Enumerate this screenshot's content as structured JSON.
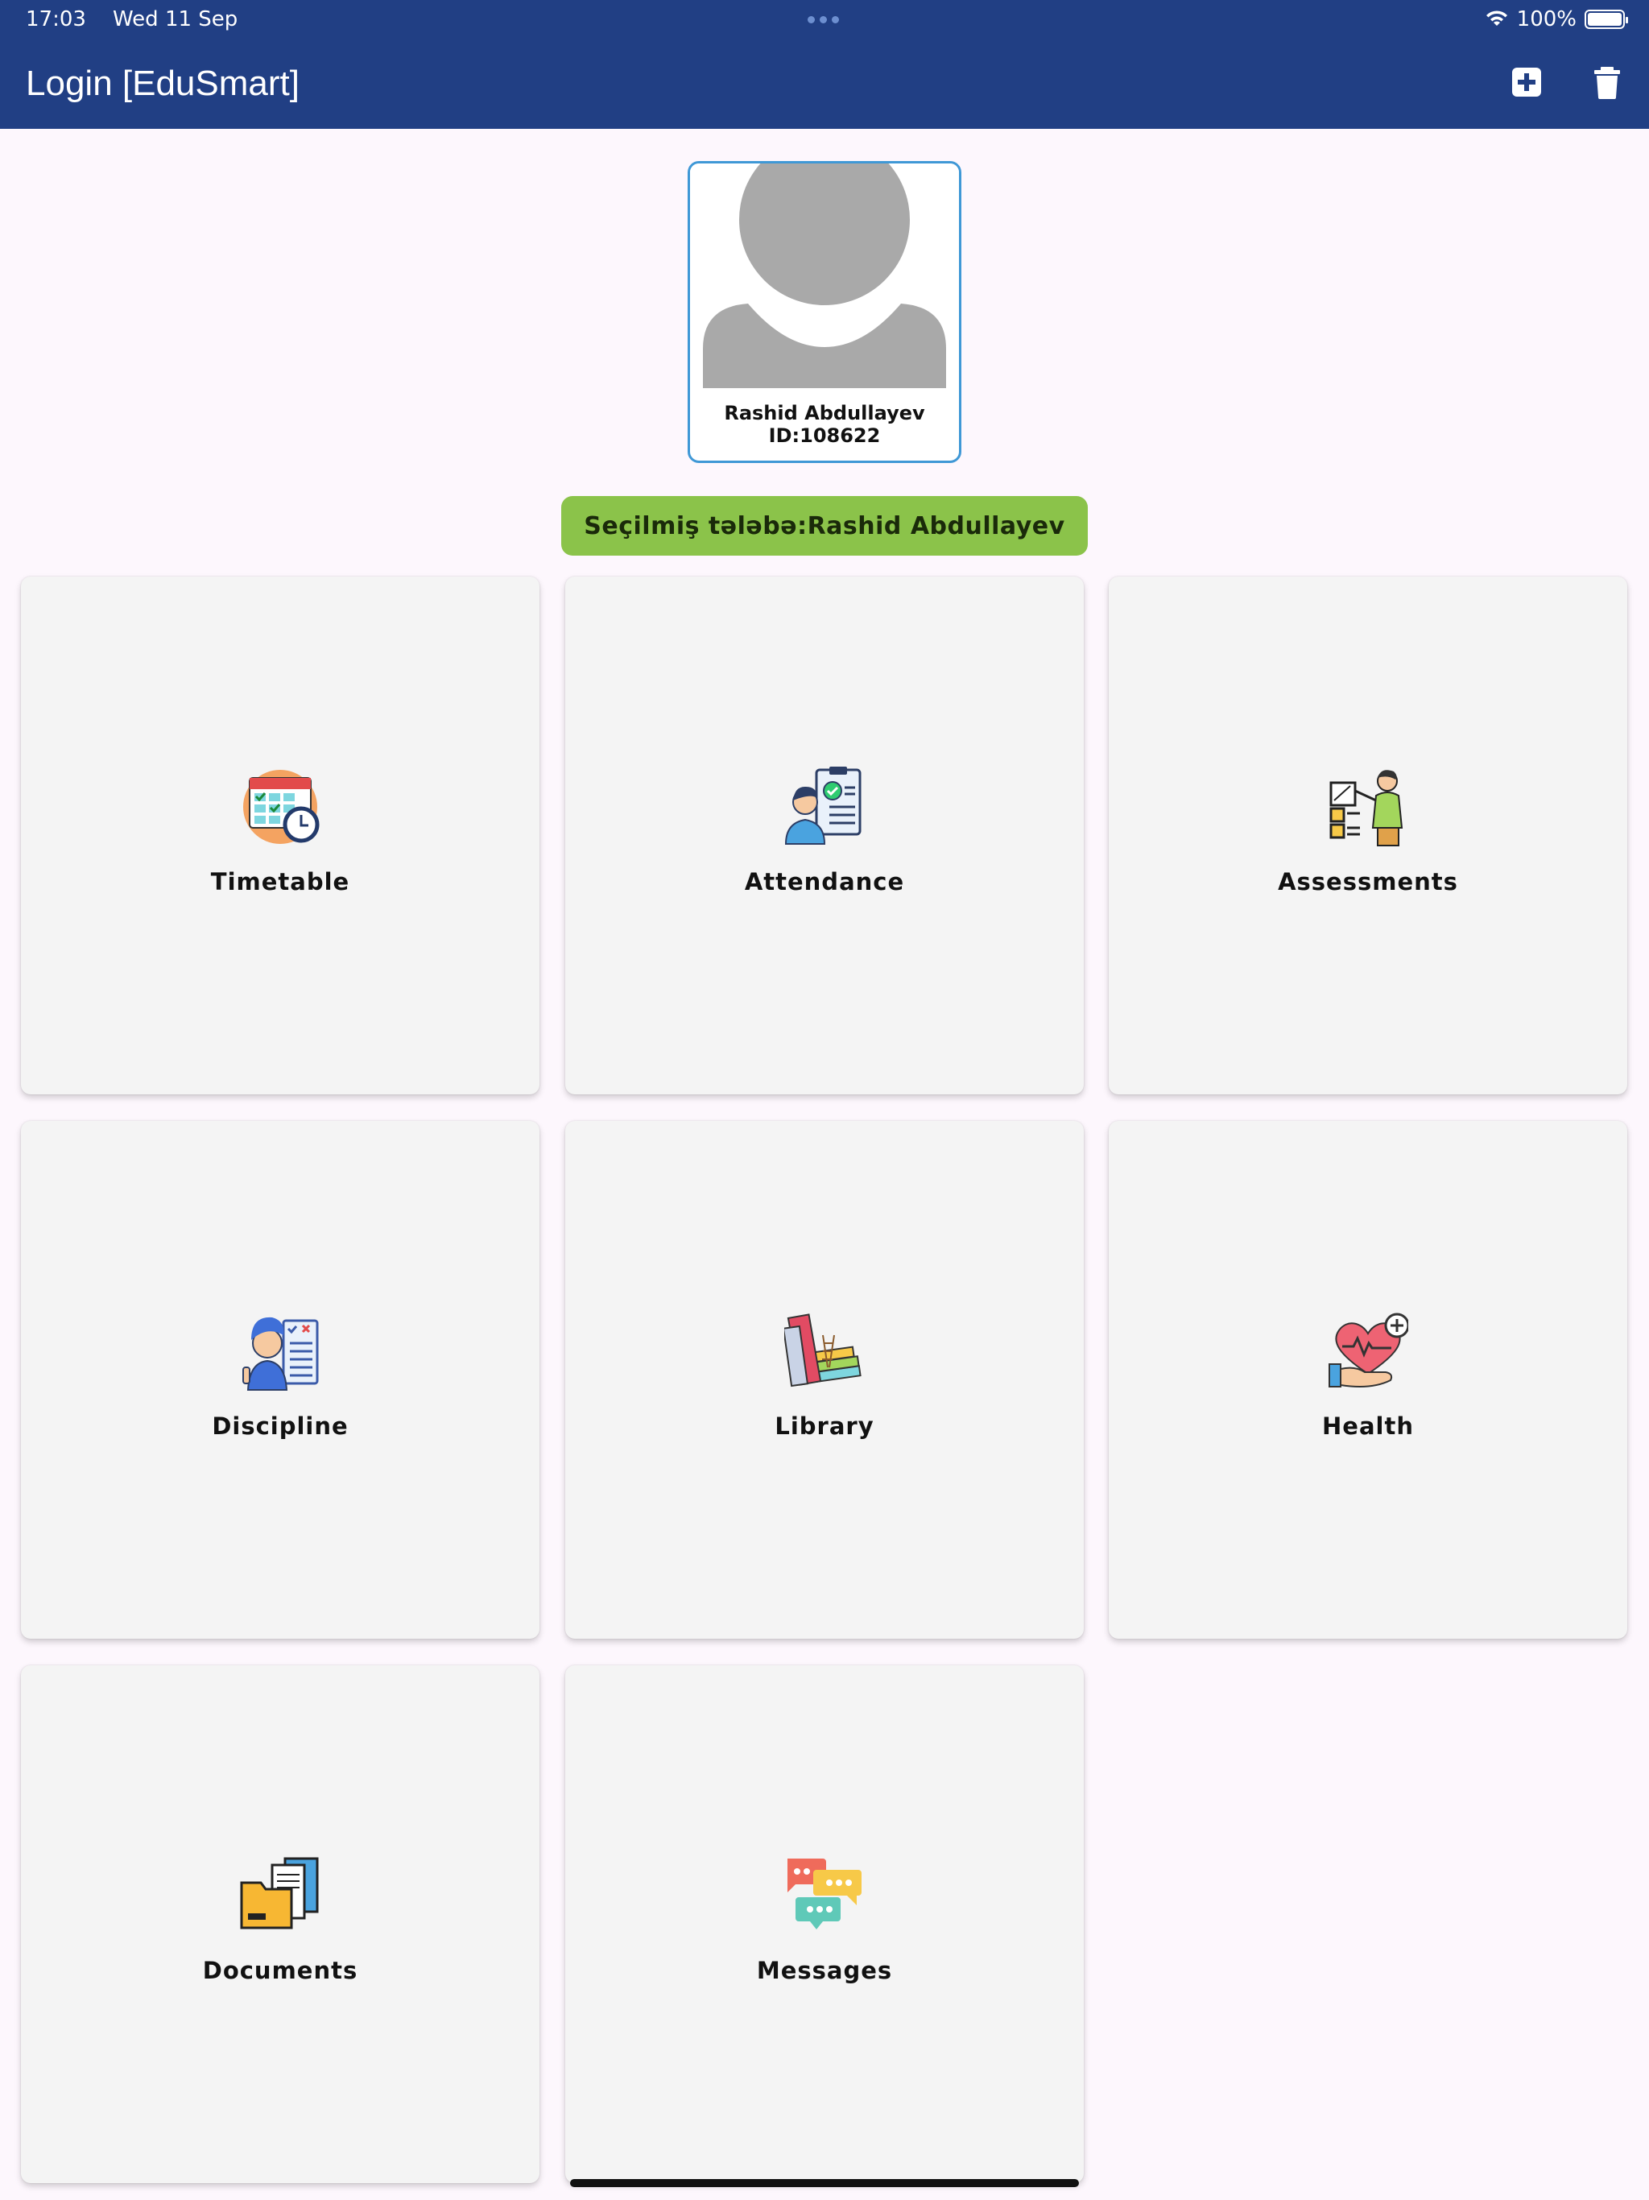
{
  "status_bar": {
    "time": "17:03",
    "date": "Wed 11 Sep",
    "battery": "100%",
    "icons": [
      "wifi-icon",
      "battery-icon"
    ]
  },
  "header": {
    "title": "Login [EduSmart]",
    "actions": [
      "add-icon",
      "trash-icon"
    ],
    "background": "#213f84"
  },
  "profile": {
    "name": "Rashid Abdullayev",
    "id": "ID:108622",
    "avatar_icon": "default-avatar-icon"
  },
  "selected_student": {
    "label": "Seçilmiş tələbə:Rashid Abdullayev",
    "color": "#8bc34a"
  },
  "tiles": [
    {
      "label": "Timetable",
      "icon": "calendar-clock-icon"
    },
    {
      "label": "Attendance",
      "icon": "attendance-clipboard-icon"
    },
    {
      "label": "Assessments",
      "icon": "teacher-board-icon"
    },
    {
      "label": "Discipline",
      "icon": "student-checklist-icon"
    },
    {
      "label": "Library",
      "icon": "books-icon"
    },
    {
      "label": "Health",
      "icon": "heart-hand-icon"
    },
    {
      "label": "Documents",
      "icon": "folder-documents-icon"
    },
    {
      "label": "Messages",
      "icon": "chat-bubbles-icon"
    }
  ]
}
